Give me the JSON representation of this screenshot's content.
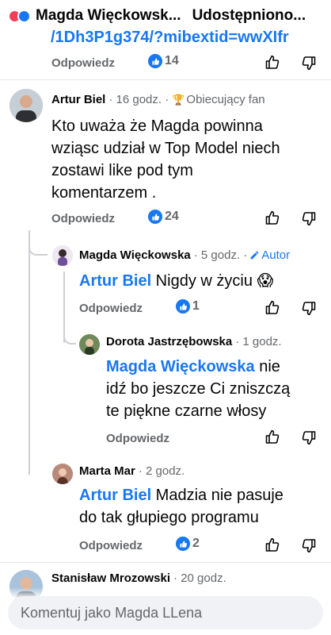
{
  "header": {
    "author": "Magda Więckowsk...",
    "shared": "Udostępniono..."
  },
  "top_comment_tail": {
    "link_text": "/1Dh3P1g374/?mibextid=wwXIfr",
    "reply_label": "Odpowiedz",
    "like_count": "14"
  },
  "comments": [
    {
      "author": "Artur Biel",
      "time": "· 16 godz. ·",
      "badge": "Obiecujący fan",
      "text_lines": [
        "Kto uważa że Magda powinna",
        "wziąsc udział w Top Model niech",
        "zostawi like  pod tym",
        "komentarzem ."
      ],
      "reply_label": "Odpowiedz",
      "like_count": "24"
    },
    {
      "author": "Magda Więckowska",
      "time": "· 5 godz. ·",
      "badge": "Autor",
      "mention": "Artur Biel",
      "text": " Nigdy w życiu 😱",
      "reply_label": "Odpowiedz",
      "like_count": "1"
    },
    {
      "author": "Dorota Jastrzębowska",
      "time": "· 1 godz.",
      "mention": "Magda Więckowska",
      "text_line1": " nie",
      "text_line2": "idź bo jeszcze Ci zniszczą",
      "text_line3": "te piękne czarne włosy",
      "reply_label": "Odpowiedz"
    },
    {
      "author": "Marta Mar",
      "time": "· 2 godz.",
      "mention": "Artur Biel",
      "text_line1": " Madzia nie pasuje",
      "text_line2": "do tak głupiego programu",
      "reply_label": "Odpowiedz",
      "like_count": "2"
    },
    {
      "author": "Stanisław Mrozowski",
      "time": "· 20 godz."
    }
  ],
  "compose": {
    "placeholder": "Komentuj jako Magda LLena"
  },
  "colors": {
    "accent": "#1877f2",
    "heart": "#f33e58",
    "secondary_text": "#65676b"
  }
}
